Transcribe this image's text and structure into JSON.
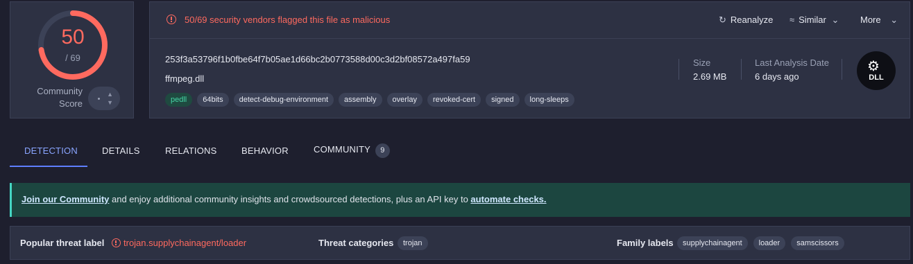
{
  "score": {
    "detections": "50",
    "total": "/ 69",
    "fraction": 0.7246,
    "community_label": "Community\nScore",
    "ring_color": "#ff6a5f"
  },
  "banner": {
    "alert_text": "50/69 security vendors flagged this file as malicious",
    "reanalyze": "Reanalyze",
    "similar": "Similar",
    "more": "More"
  },
  "file": {
    "hash": "253f3a53796f1b0fbe64f7b05ae1d66bc2b0773588d00c3d2bf08572a497fa59",
    "name": "ffmpeg.dll",
    "tags": [
      "pedll",
      "64bits",
      "detect-debug-environment",
      "assembly",
      "overlay",
      "revoked-cert",
      "signed",
      "long-sleeps"
    ],
    "size_label": "Size",
    "size_value": "2.69 MB",
    "date_label": "Last Analysis Date",
    "date_value": "6 days ago",
    "type_badge": "DLL"
  },
  "tabs": [
    {
      "label": "DETECTION",
      "active": true
    },
    {
      "label": "DETAILS"
    },
    {
      "label": "RELATIONS"
    },
    {
      "label": "BEHAVIOR"
    },
    {
      "label": "COMMUNITY",
      "count": "9"
    }
  ],
  "community_banner": {
    "link1": "Join our Community",
    "middle": " and enjoy additional community insights and crowdsourced detections, plus an API key to ",
    "link2": "automate checks."
  },
  "threat": {
    "popular_label": "Popular threat label",
    "popular_value": "trojan.supplychainagent/loader",
    "categories_label": "Threat categories",
    "categories": [
      "trojan"
    ],
    "family_label": "Family labels",
    "families": [
      "supplychainagent",
      "loader",
      "samscissors"
    ]
  }
}
